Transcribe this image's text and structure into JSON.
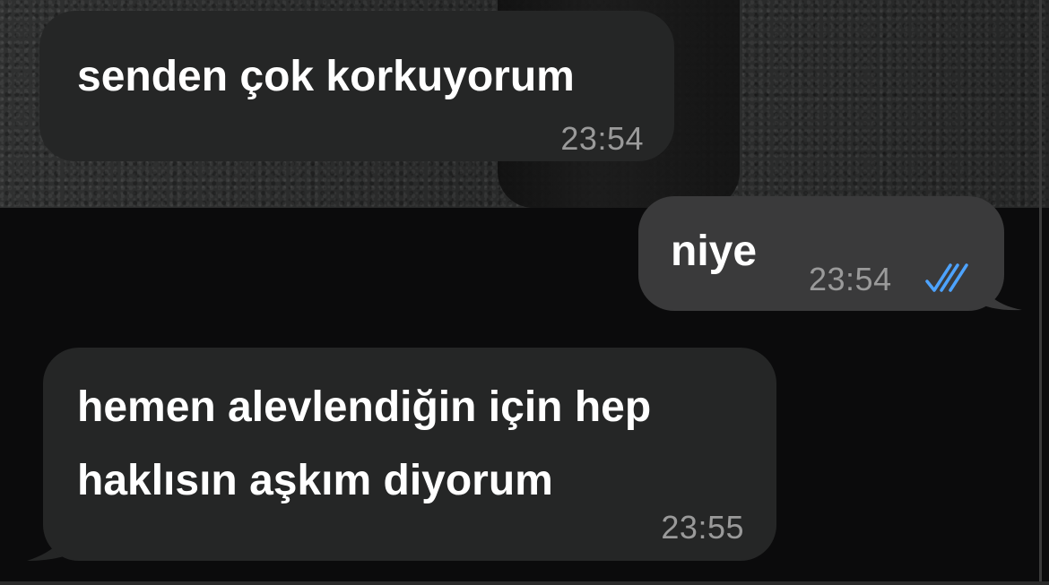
{
  "messages": [
    {
      "direction": "incoming",
      "text": "senden çok korkuyorum",
      "time": "23:54"
    },
    {
      "direction": "outgoing",
      "text": "niye",
      "time": "23:54",
      "status_icon": "double-check-read-icon",
      "status_color": "#4da3ff"
    },
    {
      "direction": "incoming",
      "lines": [
        "hemen alevlendiğin için hep",
        "haklısın aşkım diyorum"
      ],
      "time": "23:55"
    }
  ],
  "colors": {
    "incoming_bubble": "#252626",
    "outgoing_bubble": "#3a3a3b",
    "timestamp": "#9a9a9a",
    "text": "#ffffff",
    "read_ticks": "#4da3ff"
  }
}
